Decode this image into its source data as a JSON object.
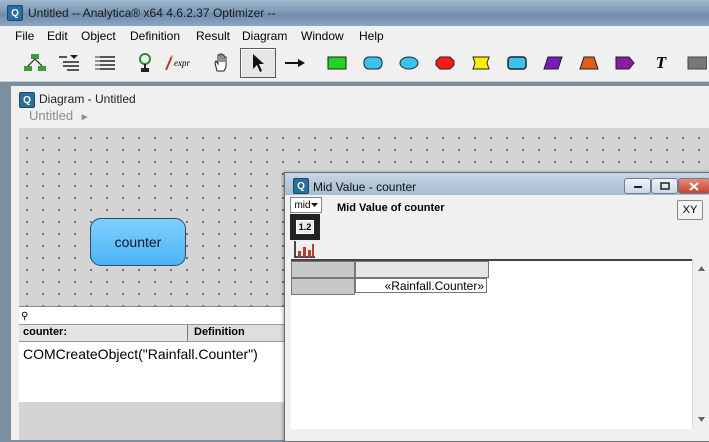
{
  "app": {
    "title": "Untitled -- Analytica® x64 4.6.2.37 Optimizer --",
    "icon": "analytica-app-icon"
  },
  "menu": [
    "File",
    "Edit",
    "Object",
    "Definition",
    "Result",
    "Diagram",
    "Window",
    "Help"
  ],
  "toolbar": {
    "tools": [
      "diagram-network-icon",
      "outline-icon",
      "list-icon",
      "hierarchy-icon",
      "expression-icon",
      "browse-hand-icon",
      "arrow-pointer-icon",
      "connector-arrow-icon",
      "decision-node-icon",
      "chance-node-icon",
      "objective-node-icon",
      "variable-node-icon",
      "constant-node-icon",
      "index-node-icon",
      "module-node-icon",
      "function-node-icon",
      "alias-node-icon",
      "text-tool-icon",
      "picture-icon"
    ],
    "expr_label": "expr",
    "text_tool_label": "T",
    "node_colors": [
      "#22d422",
      "#38c4ef",
      "#38c4ef",
      "#ff1a1a",
      "#ffee00",
      "#38c4ef",
      "#7a1bb8",
      "#e25d12",
      "#8a1aa8"
    ]
  },
  "diagram_window": {
    "title": "Diagram - Untitled",
    "breadcrumb": "Untitled",
    "breadcrumb_arrow": "►",
    "node": {
      "label": "counter",
      "color": "#4bb4f7"
    }
  },
  "attribute_pane": {
    "pin": "⚲",
    "object_name": "counter:",
    "attribute": "Definition",
    "definition_text": "COMCreateObject(\"Rainfall.Counter\")"
  },
  "result_window": {
    "title": "Mid Value - counter",
    "heading": "Mid Value of counter",
    "view_selector": "mid",
    "table_button": "1.2",
    "xy_button": "XY",
    "cell_value": "«Rainfall.Counter»"
  }
}
